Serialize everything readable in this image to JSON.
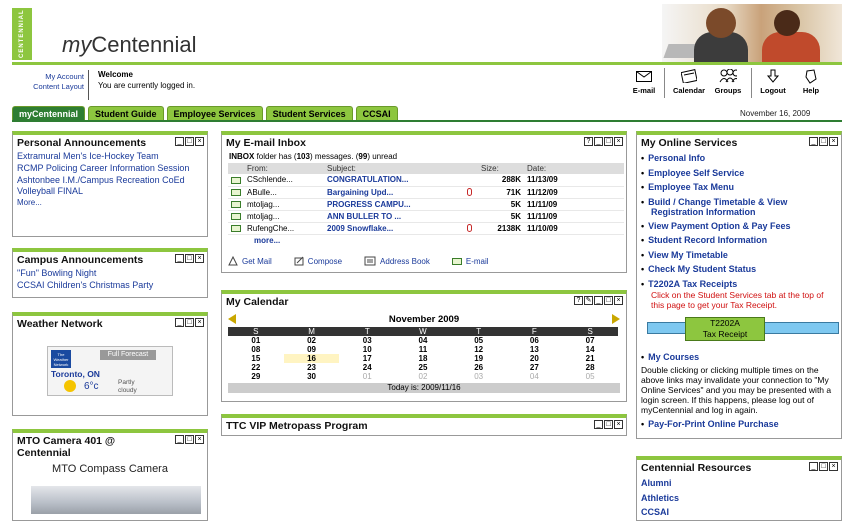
{
  "brand": {
    "vertical_text": "CENTENNIAL",
    "title_prefix": "my",
    "title_suffix": "Centennial"
  },
  "top_left": {
    "line1": "My Account",
    "line2": "Content Layout"
  },
  "welcome": {
    "heading": "Welcome",
    "status": "You are currently logged in."
  },
  "tools": [
    {
      "icon": "email-icon",
      "label": "E-mail"
    },
    {
      "icon": "calendar-icon",
      "label": "Calendar"
    },
    {
      "icon": "groups-icon",
      "label": "Groups"
    },
    {
      "icon": "logout-icon",
      "label": "Logout"
    },
    {
      "icon": "help-icon",
      "label": "Help"
    }
  ],
  "tabs": [
    "myCentennial",
    "Student Guide",
    "Employee Services",
    "Student Services",
    "CCSAI"
  ],
  "date": "November 16, 2009",
  "personal": {
    "title": "Personal Announcements",
    "items": [
      "Extramural Men's Ice-Hockey Team",
      "RCMP Policing Career Information Session",
      "Ashtonbee I.M./Campus Recreation CoEd Volleyball FINAL"
    ],
    "more": "More..."
  },
  "campus": {
    "title": "Campus Announcements",
    "items": [
      "\"Fun\" Bowling Night",
      "CCSAI Children's Christmas Party"
    ]
  },
  "weather": {
    "title": "Weather Network",
    "logo_text": "The Weather Network",
    "button": "Full Forecast",
    "city": "Toronto, ON",
    "temp": "6°c",
    "desc": "Partly cloudy"
  },
  "mto": {
    "title": "MTO Camera 401 @ Centennial",
    "caption": "MTO Compass Camera"
  },
  "inbox": {
    "title": "My E-mail Inbox",
    "summary_prefix": "INBOX",
    "summary_mid": " folder has (",
    "count": "103",
    "summary_mid2": ") messages. (",
    "unread": "99",
    "summary_end": ") unread",
    "columns": [
      "From:",
      "Subject:",
      "Size:",
      "Date:"
    ],
    "rows": [
      {
        "from": "CSchlende...",
        "subject": "CONGRATULATION...",
        "attach": false,
        "size": "288K",
        "date": "11/13/09"
      },
      {
        "from": "ABulle...",
        "subject": "Bargaining Upd...",
        "attach": true,
        "size": "71K",
        "date": "11/12/09"
      },
      {
        "from": "mtoljag...",
        "subject": "PROGRESS CAMPU...",
        "attach": false,
        "size": "5K",
        "date": "11/11/09"
      },
      {
        "from": "mtoljag...",
        "subject": "ANN BULLER TO ...",
        "attach": false,
        "size": "5K",
        "date": "11/11/09"
      },
      {
        "from": "RufengChe...",
        "subject": "2009 Snowflake...",
        "attach": true,
        "size": "2138K",
        "date": "11/10/09"
      }
    ],
    "more": "more...",
    "actions": [
      "Get Mail",
      "Compose",
      "Address Book",
      "E-mail"
    ]
  },
  "calendar": {
    "title": "My Calendar",
    "month": "November 2009",
    "days": [
      "S",
      "M",
      "T",
      "W",
      "T",
      "F",
      "S"
    ],
    "weeks": [
      [
        "01",
        "02",
        "03",
        "04",
        "05",
        "06",
        "07"
      ],
      [
        "08",
        "09",
        "10",
        "11",
        "12",
        "13",
        "14"
      ],
      [
        "15",
        "16",
        "17",
        "18",
        "19",
        "20",
        "21"
      ],
      [
        "22",
        "23",
        "24",
        "25",
        "26",
        "27",
        "28"
      ],
      [
        "29",
        "30",
        "01",
        "02",
        "03",
        "04",
        "05"
      ]
    ],
    "today_label": "Today is: 2009/11/16"
  },
  "ttc": {
    "title": "TTC VIP Metropass Program"
  },
  "online": {
    "title": "My Online Services",
    "items": [
      "Personal Info",
      "Employee Self Service",
      "Employee Tax Menu",
      "Build / Change Timetable & View Registration Information",
      "View Payment Option & Pay Fees",
      "Student Record Information",
      "View My Timetable",
      "Check My Student Status",
      "T2202A Tax Receipts"
    ],
    "red_note": "Click on the Student Services tab at the top of this page to get your Tax Receipt.",
    "receipt_line1": "T2202A",
    "receipt_line2": "Tax Receipt",
    "courses": "My Courses",
    "warning": "Double clicking or clicking multiple times on the above links may invalidate your connection to \"My Online Services\" and you may be presented with a login screen. If this happens, please log out of myCentennial and log in again.",
    "pay_print": "Pay-For-Print Online Purchase"
  },
  "resources": {
    "title": "Centennial Resources",
    "items": [
      "Alumni",
      "Athletics",
      "CCSAI"
    ]
  },
  "panel_controls": [
    "minimize",
    "maximize",
    "close"
  ]
}
